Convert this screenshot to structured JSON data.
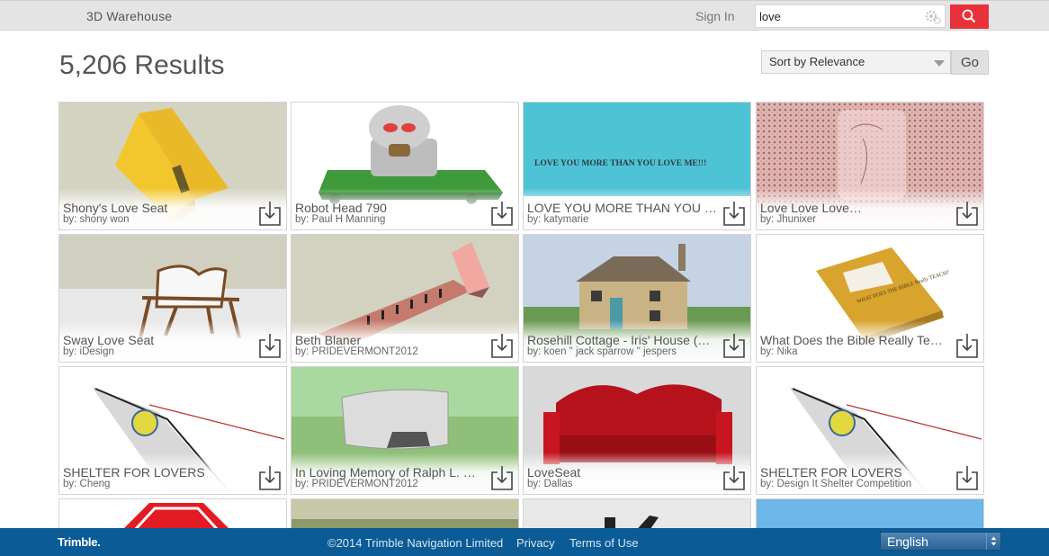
{
  "header": {
    "brand": "3D Warehouse",
    "sign_in": "Sign In",
    "search_value": "love"
  },
  "results": {
    "count_label": "5,206 Results",
    "sort_label": "Sort by Relevance",
    "go_label": "Go"
  },
  "cards": [
    {
      "title": "Shony's Love Seat",
      "author": "by: shony won"
    },
    {
      "title": "Robot Head 790",
      "author": "by: Paul H Manning"
    },
    {
      "title": "LOVE YOU MORE THAN YOU …",
      "author": "by: katymarie",
      "thumb_text": "LOVE YOU MORE THAN YOU LOVE ME!!!"
    },
    {
      "title": "Love Love Love…",
      "author": "by: Jhunixer"
    },
    {
      "title": "Sway Love Seat",
      "author": "by: iDesign"
    },
    {
      "title": "Beth Blaner",
      "author": "by: PRIDEVERMONT2012"
    },
    {
      "title": "Rosehill Cottage - Iris' House (…",
      "author": "by: koen \" jack sparrow \" jespers"
    },
    {
      "title": "What Does the Bible Really Te…",
      "author": "by: Nika",
      "thumb_text": "WHAT DOES THE BIBLE Really TEACH?"
    },
    {
      "title": "SHELTER FOR LOVERS",
      "author": "by: Cheng"
    },
    {
      "title": "In Loving Memory of Ralph L. …",
      "author": "by: PRIDEVERMONT2012"
    },
    {
      "title": "LoveSeat",
      "author": "by: Dallas"
    },
    {
      "title": "SHELTER FOR LOVERS",
      "author": "by: Design It Shelter Competition"
    }
  ],
  "footer": {
    "logo": "Trimble.",
    "copyright": "©2014 Trimble Navigation Limited",
    "privacy": "Privacy",
    "terms": "Terms of Use",
    "language": "English"
  },
  "colors": {
    "accent_red": "#e8313b",
    "footer_blue": "#0a5b96",
    "topbar_gray": "#e4e4e4"
  },
  "icons": [
    "gear-icon",
    "search-icon",
    "download-icon",
    "select-arrows-icon"
  ]
}
